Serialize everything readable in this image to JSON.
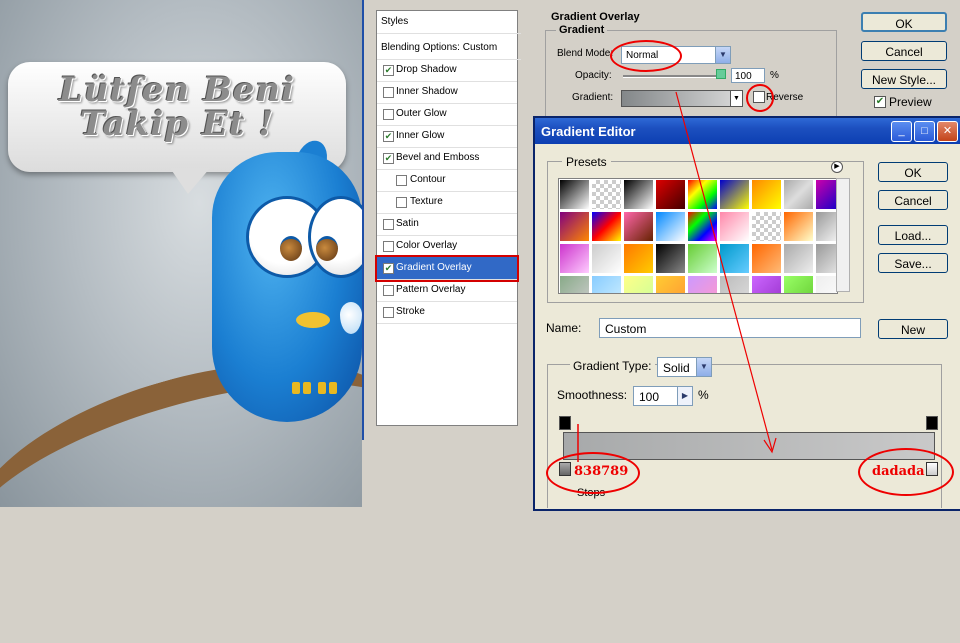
{
  "artwork": {
    "bubble_line1": "Lütfen Beni",
    "bubble_line2": "Takip Et !"
  },
  "layer_style": {
    "styles_header": "Styles",
    "blending_options": "Blending Options: Custom",
    "items": [
      {
        "label": "Drop Shadow",
        "checked": true,
        "indent": false
      },
      {
        "label": "Inner Shadow",
        "checked": false,
        "indent": false
      },
      {
        "label": "Outer Glow",
        "checked": false,
        "indent": false
      },
      {
        "label": "Inner Glow",
        "checked": true,
        "indent": false
      },
      {
        "label": "Bevel and Emboss",
        "checked": true,
        "indent": false
      },
      {
        "label": "Contour",
        "checked": false,
        "indent": true
      },
      {
        "label": "Texture",
        "checked": false,
        "indent": true
      },
      {
        "label": "Satin",
        "checked": false,
        "indent": false
      },
      {
        "label": "Color Overlay",
        "checked": false,
        "indent": false
      },
      {
        "label": "Gradient Overlay",
        "checked": true,
        "indent": false,
        "selected": true
      },
      {
        "label": "Pattern Overlay",
        "checked": false,
        "indent": false
      },
      {
        "label": "Stroke",
        "checked": false,
        "indent": false
      }
    ],
    "section_title": "Gradient Overlay",
    "group_title": "Gradient",
    "blend_mode_label": "Blend Mode:",
    "blend_mode_value": "Normal",
    "opacity_label": "Opacity:",
    "opacity_value": "100",
    "opacity_unit": "%",
    "gradient_label": "Gradient:",
    "reverse_label": "Reverse",
    "buttons": {
      "ok": "OK",
      "cancel": "Cancel",
      "new_style": "New Style...",
      "preview": "Preview"
    },
    "preview_checked": true
  },
  "gradient_editor": {
    "title": "Gradient Editor",
    "presets_label": "Presets",
    "buttons": {
      "ok": "OK",
      "cancel": "Cancel",
      "load": "Load...",
      "save": "Save...",
      "new": "New"
    },
    "name_label": "Name:",
    "name_value": "Custom",
    "gradient_type_label": "Gradient Type:",
    "gradient_type_value": "Solid",
    "smoothness_label": "Smoothness:",
    "smoothness_value": "100",
    "smoothness_unit": "%",
    "stops_label": "Stops",
    "left_stop_color": "838789",
    "right_stop_color": "dadada"
  },
  "colors": {
    "gradient_start": "#838789",
    "gradient_end": "#dadada",
    "annotation": "#e00000",
    "selection": "#3169c6",
    "titlebar": "#1c4fbf"
  }
}
